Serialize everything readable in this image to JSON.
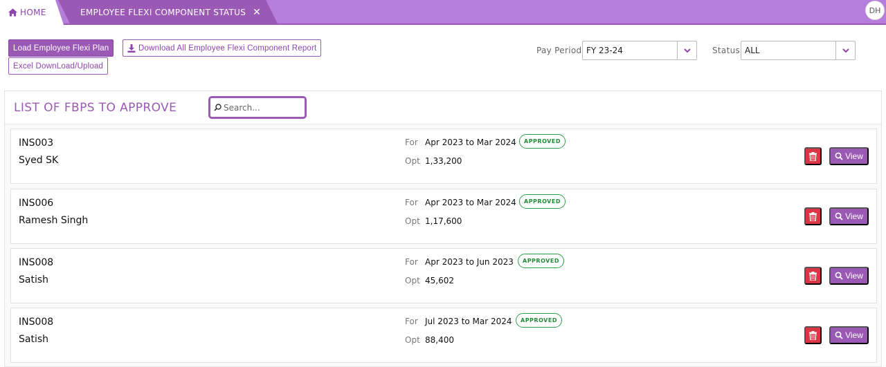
{
  "topbar": {
    "home_label": "HOME",
    "home_icon": "home-icon",
    "active_tab_label": "EMPLOYEE FLEXI COMPONENT STATUS",
    "close_icon": "close-icon",
    "avatar_initials": "DH"
  },
  "toolbar": {
    "load_label": "Load Employee Flexi Plan",
    "download_label": "Download All Employee Flexi Component Report",
    "download_icon": "download-icon",
    "excel_label": "Excel DownLoad/Upload"
  },
  "filters": {
    "pay_period_label": "Pay Period",
    "pay_period_value": "FY 23-24",
    "status_label": "Status",
    "status_value": "ALL"
  },
  "panel": {
    "title": "LIST OF FBPS TO APPROVE",
    "search_placeholder": "Search..."
  },
  "labels": {
    "for": "For",
    "opt": "Opt",
    "view": "View"
  },
  "records": [
    {
      "code": "INS003",
      "name": "Syed SK",
      "period": "Apr 2023 to Mar 2024",
      "status": "APPROVED",
      "opt": "1,33,200"
    },
    {
      "code": "INS006",
      "name": "Ramesh Singh",
      "period": "Apr 2023 to Mar 2024",
      "status": "APPROVED",
      "opt": "1,17,600"
    },
    {
      "code": "INS008",
      "name": "Satish",
      "period": "Apr 2023 to Jun 2023",
      "status": "APPROVED",
      "opt": "45,602"
    },
    {
      "code": "INS008",
      "name": "Satish",
      "period": "Jul 2023 to Mar 2024",
      "status": "APPROVED",
      "opt": "88,400"
    }
  ],
  "colors": {
    "accent": "#9b59b6",
    "topbar": "#b57edc",
    "danger": "#dc3545",
    "approved": "#2e9e48"
  }
}
